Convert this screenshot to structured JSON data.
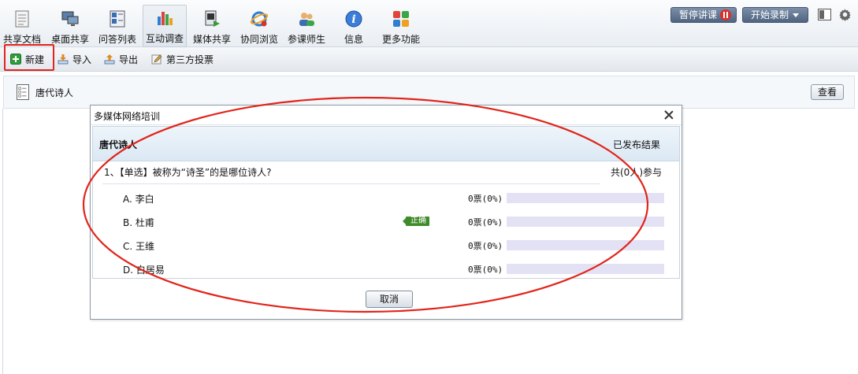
{
  "toolbar": {
    "tools": [
      {
        "label": "共享文档",
        "icon": "document-icon"
      },
      {
        "label": "桌面共享",
        "icon": "desktop-share-icon"
      },
      {
        "label": "问答列表",
        "icon": "qa-list-icon"
      },
      {
        "label": "互动调查",
        "icon": "survey-chart-icon"
      },
      {
        "label": "媒体共享",
        "icon": "media-share-icon"
      },
      {
        "label": "协同浏览",
        "icon": "co-browse-icon"
      },
      {
        "label": "参课师生",
        "icon": "participants-icon"
      },
      {
        "label": "信息",
        "icon": "info-icon"
      },
      {
        "label": "更多功能",
        "icon": "more-apps-icon"
      }
    ],
    "pause_label": "暂停讲课",
    "record_label": "开始录制"
  },
  "subtoolbar": {
    "new_label": "新建",
    "import_label": "导入",
    "export_label": "导出",
    "third_party_label": "第三方投票"
  },
  "list": {
    "item_title": "唐代诗人",
    "view_label": "查看"
  },
  "dialog": {
    "title": "多媒体网络培训",
    "survey_name": "唐代诗人",
    "status": "已发布结果",
    "question": "1、【单选】被称为“诗圣”的是哪位诗人?",
    "participants": "共(0人)参与",
    "correct_label": "正确",
    "options": [
      {
        "label": "A. 李白",
        "votes": "0票(0%)",
        "fraction": 0
      },
      {
        "label": "B. 杜甫",
        "votes": "0票(0%)",
        "fraction": 0
      },
      {
        "label": "C. 王维",
        "votes": "0票(0%)",
        "fraction": 0
      },
      {
        "label": "D. 白居易",
        "votes": "0票(0%)",
        "fraction": 0
      }
    ],
    "cancel_label": "取消"
  },
  "colors": {
    "annotation_red": "#e1251b",
    "correct_green": "#3f8b2a",
    "bar_track": "#e3e1f4"
  }
}
